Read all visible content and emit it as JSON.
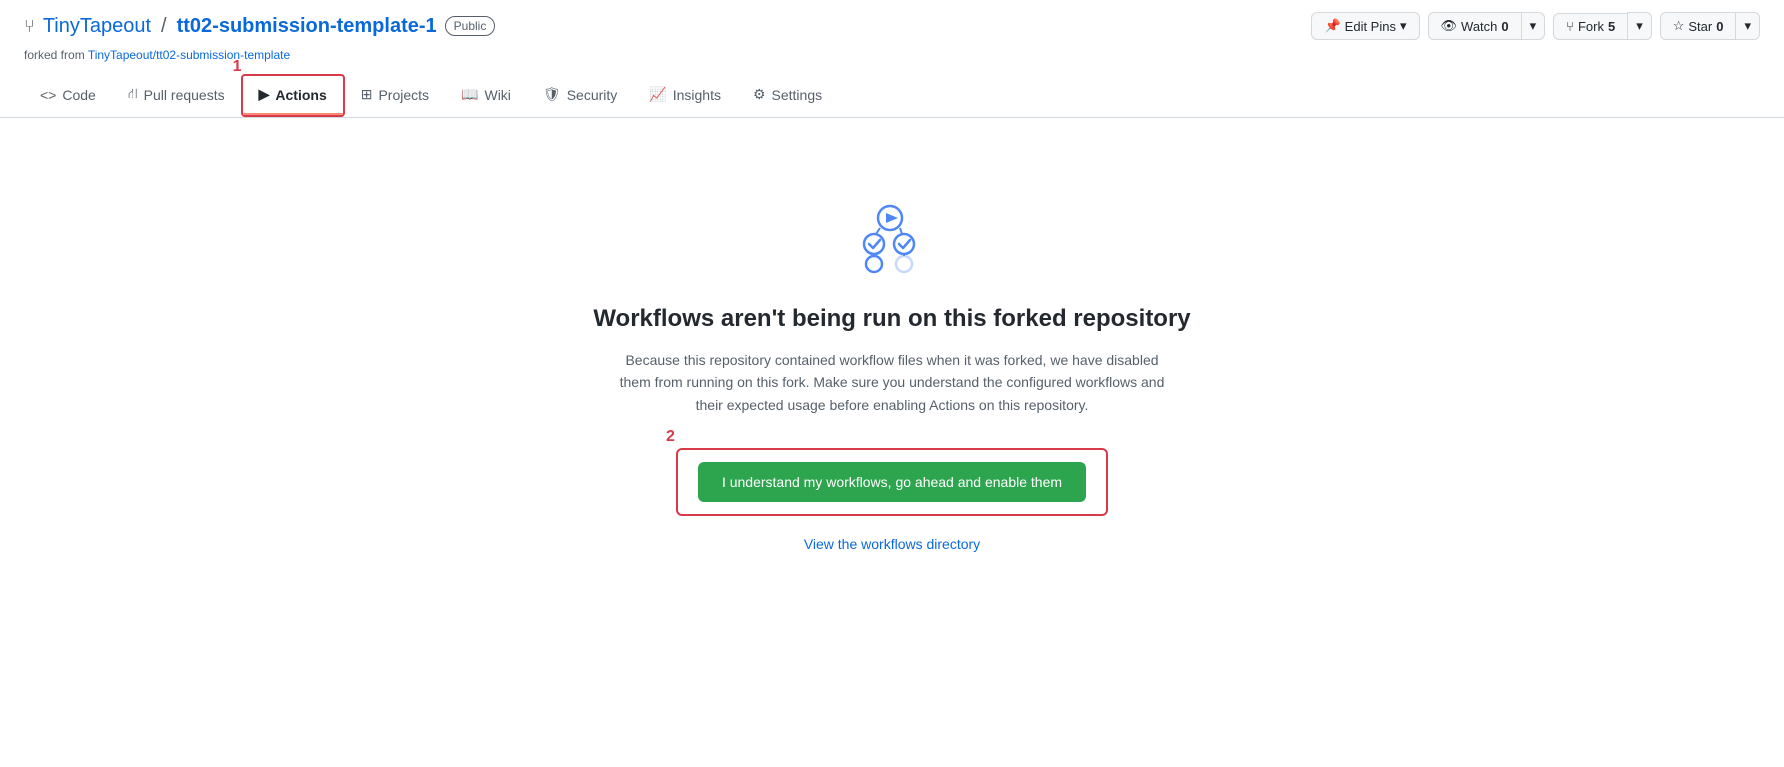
{
  "repo": {
    "owner": "TinyTapeout",
    "separator": "/",
    "name": "tt02-submission-template-1",
    "visibility": "Public",
    "forked_from_label": "forked from",
    "forked_from_link": "TinyTapeout/tt02-submission-template",
    "forked_from_url": "#"
  },
  "header_buttons": {
    "edit_pins": "Edit Pins",
    "watch": "Watch",
    "watch_count": "0",
    "fork": "Fork",
    "fork_count": "5",
    "star": "Star",
    "star_count": "0"
  },
  "nav": {
    "code": "Code",
    "pull_requests": "Pull requests",
    "actions": "Actions",
    "projects": "Projects",
    "wiki": "Wiki",
    "security": "Security",
    "insights": "Insights",
    "settings": "Settings"
  },
  "main": {
    "title": "Workflows aren't being run on this forked repository",
    "description": "Because this repository contained workflow files when it was forked, we have disabled them from running on this fork. Make sure you understand the configured workflows and their expected usage before enabling Actions on this repository.",
    "enable_button": "I understand my workflows, go ahead and enable them",
    "view_workflows_link": "View the workflows directory"
  },
  "annotation": {
    "num1": "1",
    "num2": "2"
  }
}
